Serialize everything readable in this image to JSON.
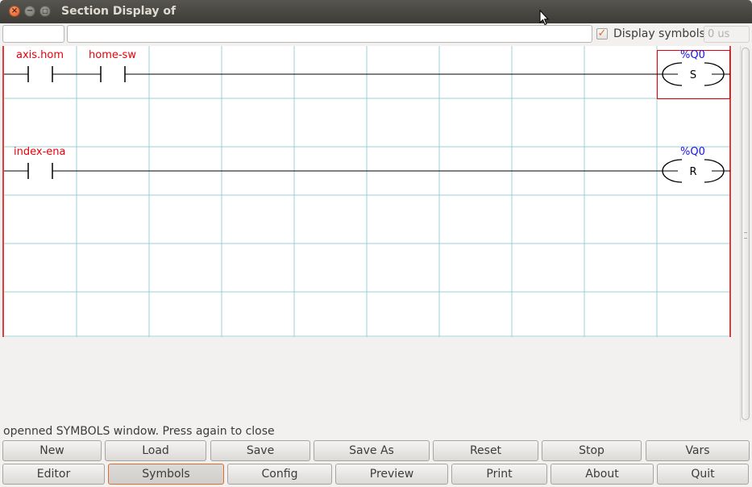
{
  "window": {
    "title": "Section Display of"
  },
  "toolbar": {
    "rung_value": "",
    "comment_value": "",
    "display_symbols_label": "Display symbols",
    "display_symbols_checked": true,
    "period_placeholder": "0 us"
  },
  "ladder": {
    "rungs": [
      {
        "contacts": [
          "axis.hom",
          "home-sw"
        ],
        "coil_label": "%Q0",
        "coil_type": "S"
      },
      {
        "contacts": [
          "index-ena"
        ],
        "coil_label": "%Q0",
        "coil_type": "R"
      }
    ],
    "colors": {
      "symbol": "#e8000b",
      "coil_label": "#1614e6",
      "grid": "#9dcfd4",
      "rail": "#e53a3a"
    }
  },
  "status": {
    "text": "openned SYMBOLS window. Press again to close"
  },
  "buttons_row1": [
    "New",
    "Load",
    "Save",
    "Save As",
    "Reset",
    "Stop",
    "Vars"
  ],
  "buttons_row2": [
    "Editor",
    "Symbols",
    "Config",
    "Preview",
    "Print",
    "About",
    "Quit"
  ],
  "active_button": "Symbols",
  "icons": {
    "close": "close-icon",
    "minimize": "minimize-icon",
    "maximize": "maximize-icon",
    "cursor": "mouse-pointer-icon"
  }
}
